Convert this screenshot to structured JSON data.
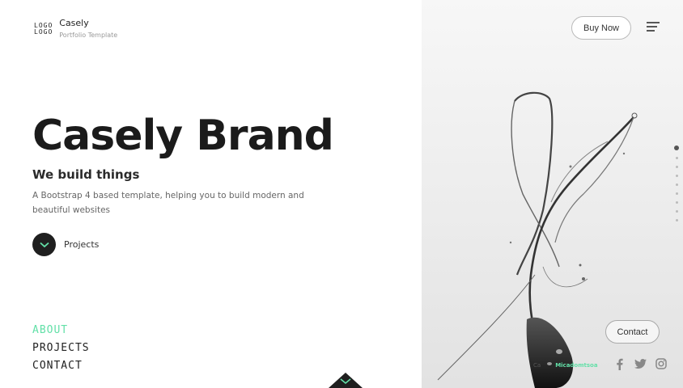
{
  "brand": {
    "logo_text": "LOGO\nLOGO",
    "name": "Casely",
    "tagline": "Portfolio Template"
  },
  "hero": {
    "title": "Casely Brand",
    "subtitle": "We build things",
    "description": "A Bootstrap 4 based template, helping you to build modern and beautiful websites",
    "projects_label": "Projects"
  },
  "nav": {
    "items": [
      {
        "label": "ABOUT",
        "active": true
      },
      {
        "label": "PROJECTS",
        "active": false
      },
      {
        "label": "CONTACT",
        "active": false
      }
    ]
  },
  "header": {
    "buy_label": "Buy Now"
  },
  "side_dots": {
    "count": 9,
    "active_index": 0
  },
  "contact": {
    "label": "Contact"
  },
  "credit": {
    "prefix": "Ca",
    "author": "Micadomtsoa"
  },
  "social": [
    "facebook-icon",
    "twitter-icon",
    "instagram-icon"
  ],
  "colors": {
    "accent": "#63e0a8",
    "dark": "#1f1f1f",
    "muted": "#666666"
  }
}
